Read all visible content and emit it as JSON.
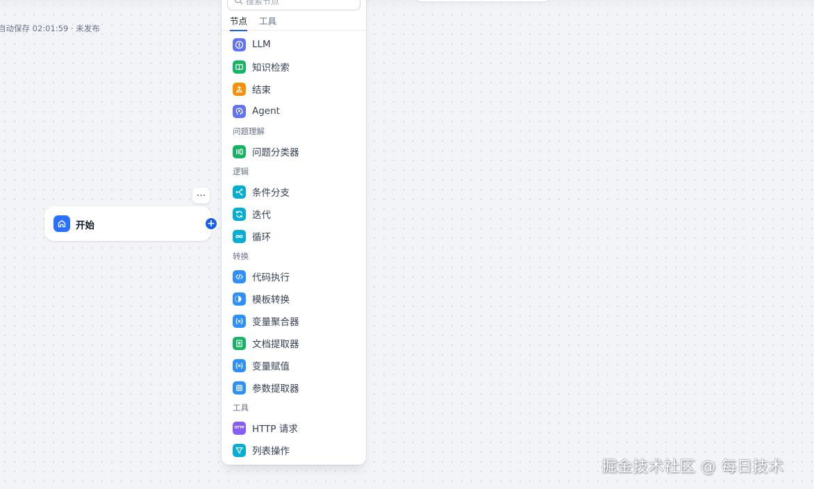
{
  "autosave": {
    "text": "自动保存 02:01:59 · 未发布"
  },
  "start_node": {
    "label": "开始",
    "more_label": "···",
    "add_label": "+"
  },
  "panel": {
    "search": {
      "placeholder": "搜索节点"
    },
    "tabs": [
      {
        "label": "节点",
        "active": true
      },
      {
        "label": "工具",
        "active": false
      }
    ],
    "groups": [
      {
        "title": "",
        "items": [
          {
            "label": "LLM",
            "icon": "llm-icon",
            "color": "#6172f3"
          },
          {
            "label": "知识检索",
            "icon": "knowledge-retrieval-icon",
            "color": "#16b364"
          },
          {
            "label": "结束",
            "icon": "end-icon",
            "color": "#f79009"
          },
          {
            "label": "Agent",
            "icon": "agent-icon",
            "color": "#6172f3"
          }
        ]
      },
      {
        "title": "问题理解",
        "items": [
          {
            "label": "问题分类器",
            "icon": "question-classifier-icon",
            "color": "#16b364"
          }
        ]
      },
      {
        "title": "逻辑",
        "items": [
          {
            "label": "条件分支",
            "icon": "if-else-icon",
            "color": "#06aed4"
          },
          {
            "label": "迭代",
            "icon": "iteration-icon",
            "color": "#06aed4"
          },
          {
            "label": "循环",
            "icon": "loop-icon",
            "color": "#06aed4"
          }
        ]
      },
      {
        "title": "转换",
        "items": [
          {
            "label": "代码执行",
            "icon": "code-icon",
            "color": "#2e90fa"
          },
          {
            "label": "模板转换",
            "icon": "template-transform-icon",
            "color": "#2e90fa"
          },
          {
            "label": "变量聚合器",
            "icon": "variable-aggregator-icon",
            "color": "#2e90fa"
          },
          {
            "label": "文档提取器",
            "icon": "doc-extractor-icon",
            "color": "#16b364"
          },
          {
            "label": "变量赋值",
            "icon": "variable-assigner-icon",
            "color": "#2e90fa"
          },
          {
            "label": "参数提取器",
            "icon": "parameter-extractor-icon",
            "color": "#2e90fa"
          }
        ]
      },
      {
        "title": "工具",
        "items": [
          {
            "label": "HTTP 请求",
            "icon": "http-request-icon",
            "color": "#875bf7",
            "icon_text": "HTTP"
          },
          {
            "label": "列表操作",
            "icon": "list-operator-icon",
            "color": "#06aed4"
          }
        ]
      }
    ]
  },
  "watermark": {
    "text": "掘金技术社区 @ 每日技术"
  },
  "colors": {
    "primary": "#155eef",
    "canvas": "#f2f4f7",
    "start": "#2970ff"
  }
}
